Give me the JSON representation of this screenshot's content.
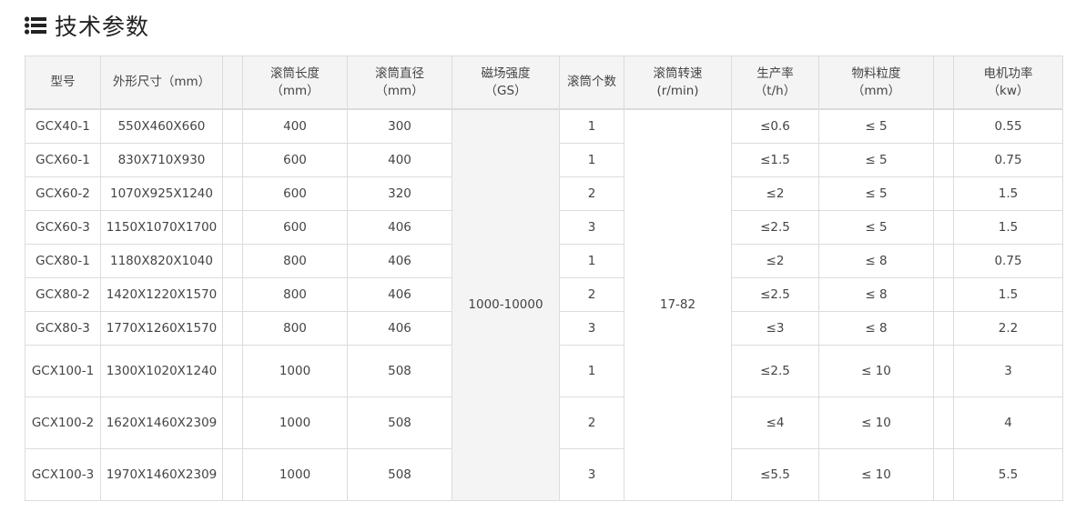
{
  "heading": {
    "title": "技术参数",
    "icon": "list-icon"
  },
  "table": {
    "headers": {
      "model": "型号",
      "dimensions": "外形尺寸（mm）",
      "drum_length_l1": "滚筒长度",
      "drum_length_l2": "（mm）",
      "drum_diameter_l1": "滚筒直径",
      "drum_diameter_l2": "（mm）",
      "magnetic_field_l1": "磁场强度",
      "magnetic_field_l2": "（GS）",
      "drum_count": "滚筒个数",
      "drum_speed_l1": "滚筒转速",
      "drum_speed_l2": "(r/min)",
      "capacity_l1": "生产率",
      "capacity_l2": "（t/h）",
      "particle_size_l1": "物料粒度",
      "particle_size_l2": "（mm）",
      "motor_power_l1": "电机功率",
      "motor_power_l2": "（kw）"
    },
    "magnetic_field_value": "1000-10000",
    "drum_speed_value": "17-82",
    "rows": [
      {
        "model": "GCX40-1",
        "dimensions": "550X460X660",
        "drum_length": "400",
        "drum_diameter": "300",
        "drum_count": "1",
        "capacity": "≤0.6",
        "particle_size": "≤ 5",
        "motor_power": "0.55"
      },
      {
        "model": "GCX60-1",
        "dimensions": "830X710X930",
        "drum_length": "600",
        "drum_diameter": "400",
        "drum_count": "1",
        "capacity": "≤1.5",
        "particle_size": "≤ 5",
        "motor_power": "0.75"
      },
      {
        "model": "GCX60-2",
        "dimensions": "1070X925X1240",
        "drum_length": "600",
        "drum_diameter": "320",
        "drum_count": "2",
        "capacity": "≤2",
        "particle_size": "≤ 5",
        "motor_power": "1.5"
      },
      {
        "model": "GCX60-3",
        "dimensions": "1150X1070X1700",
        "drum_length": "600",
        "drum_diameter": "406",
        "drum_count": "3",
        "capacity": "≤2.5",
        "particle_size": "≤ 5",
        "motor_power": "1.5"
      },
      {
        "model": "GCX80-1",
        "dimensions": "1180X820X1040",
        "drum_length": "800",
        "drum_diameter": "406",
        "drum_count": "1",
        "capacity": "≤2",
        "particle_size": "≤ 8",
        "motor_power": "0.75"
      },
      {
        "model": "GCX80-2",
        "dimensions": "1420X1220X1570",
        "drum_length": "800",
        "drum_diameter": "406",
        "drum_count": "2",
        "capacity": "≤2.5",
        "particle_size": "≤ 8",
        "motor_power": "1.5"
      },
      {
        "model": "GCX80-3",
        "dimensions": "1770X1260X1570",
        "drum_length": "800",
        "drum_diameter": "406",
        "drum_count": "3",
        "capacity": "≤3",
        "particle_size": "≤ 8",
        "motor_power": "2.2"
      },
      {
        "model": "GCX100-1",
        "dimensions": "1300X1020X1240",
        "drum_length": "1000",
        "drum_diameter": "508",
        "drum_count": "1",
        "capacity": "≤2.5",
        "particle_size": "≤ 10",
        "motor_power": "3"
      },
      {
        "model": "GCX100-2",
        "dimensions": "1620X1460X2309",
        "drum_length": "1000",
        "drum_diameter": "508",
        "drum_count": "2",
        "capacity": "≤4",
        "particle_size": "≤ 10",
        "motor_power": "4"
      },
      {
        "model": "GCX100-3",
        "dimensions": "1970X1460X2309",
        "drum_length": "1000",
        "drum_diameter": "508",
        "drum_count": "3",
        "capacity": "≤5.5",
        "particle_size": "≤ 10",
        "motor_power": "5.5"
      }
    ]
  }
}
